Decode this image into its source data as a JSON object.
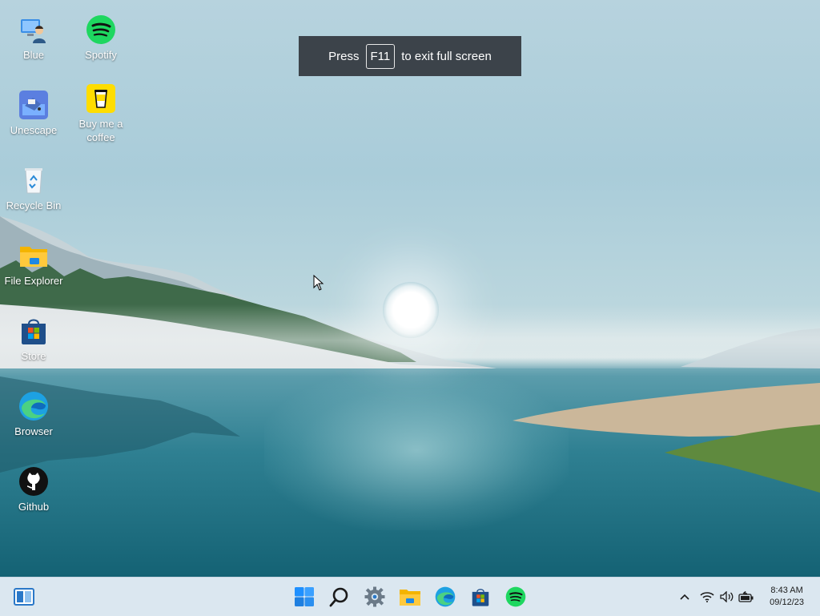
{
  "desktop": {
    "icons": [
      {
        "label": "Blue"
      },
      {
        "label": "Spotify"
      },
      {
        "label": "Unescape"
      },
      {
        "label": "Buy me a coffee"
      },
      {
        "label": "Recycle Bin"
      },
      {
        "label": "File Explorer"
      },
      {
        "label": "Store"
      },
      {
        "label": "Browser"
      },
      {
        "label": "Github"
      }
    ]
  },
  "fullscreen_banner": {
    "prefix": "Press",
    "key": "F11",
    "suffix": "to exit full screen"
  },
  "taskbar": {
    "pinned": [
      "widgets-icon",
      "start-icon",
      "search-icon",
      "settings-icon",
      "file-explorer-icon",
      "edge-icon",
      "store-icon",
      "spotify-icon"
    ],
    "tray": [
      "chevron-up-icon",
      "wifi-icon",
      "volume-icon",
      "battery-icon"
    ],
    "clock": {
      "time": "8:43 AM",
      "date": "09/12/23"
    }
  },
  "colors": {
    "taskbar": "#dbe7f0",
    "spotify": "#1ed760",
    "banner": "#3c434a"
  }
}
